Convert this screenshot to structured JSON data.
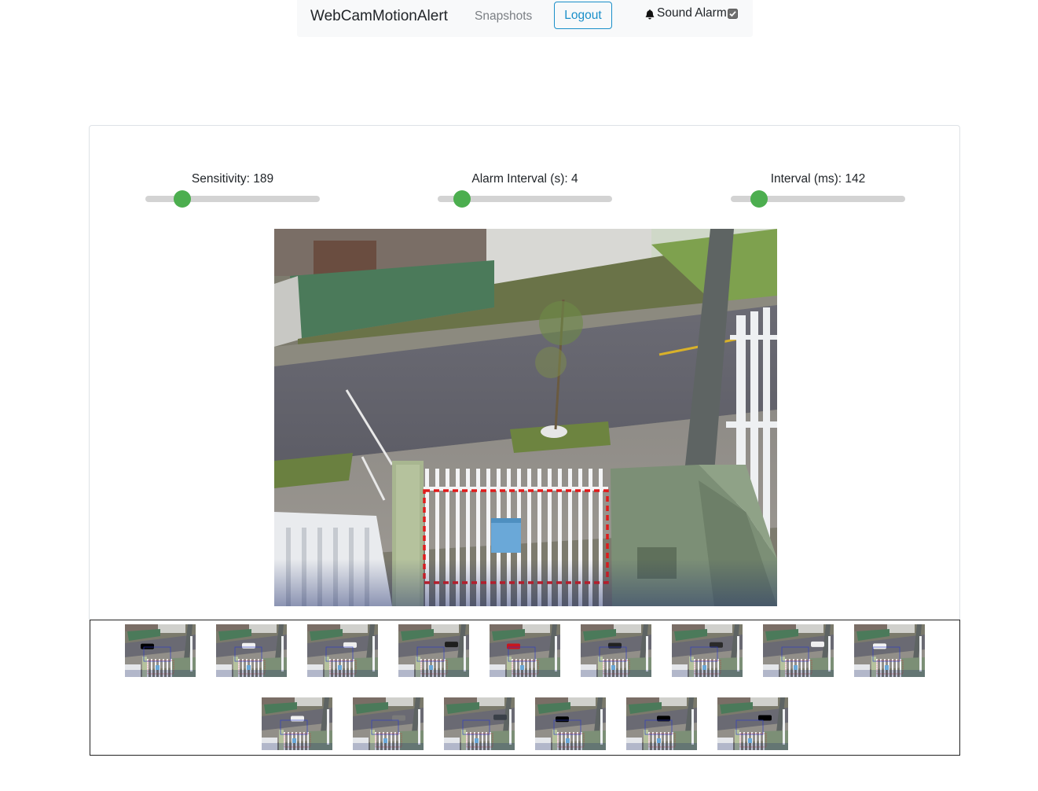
{
  "navbar": {
    "brand": "WebCamMotionAlert",
    "snapshots_link": "Snapshots",
    "logout_label": "Logout",
    "sound_alarm_label": "Sound Alarm",
    "sound_alarm_checked": true,
    "bell_icon": "bell-icon"
  },
  "controls": {
    "sensitivity": {
      "label": "Sensitivity: 189",
      "fraction": 0.21
    },
    "alarm_interval": {
      "label": "Alarm Interval (s): 4",
      "fraction": 0.14
    },
    "interval_ms": {
      "label": "Interval (ms): 142",
      "fraction": 0.16
    }
  },
  "colors": {
    "slider_thumb": "#4cae4f",
    "slider_track": "#d3d3d3",
    "logout_accent": "#1a8fc9",
    "detection_box": "#e01b1b"
  },
  "snapshots": {
    "count": 15,
    "car_colors": [
      "#000000",
      "#f2f2f2",
      "#eeeeee",
      "#1e1e1e",
      "#c8161d",
      "#222222",
      "#2a2a2a",
      "#f0f0f0",
      "#f4f4f4",
      "#f0f0f0",
      "#7a7a7a",
      "#3a4048",
      "#000000",
      "#000000",
      "#000000"
    ]
  }
}
